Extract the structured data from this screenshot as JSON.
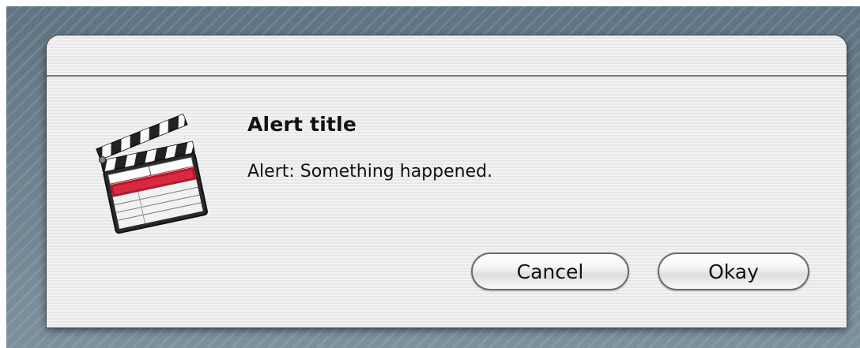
{
  "alert": {
    "title": "Alert title",
    "message": "Alert: Something happened.",
    "icon": "clapperboard-icon"
  },
  "buttons": {
    "cancel_label": "Cancel",
    "okay_label": "Okay"
  },
  "colors": {
    "desktop": "#6e8393",
    "sheet": "#ededed",
    "clapper_red": "#c0132a"
  }
}
